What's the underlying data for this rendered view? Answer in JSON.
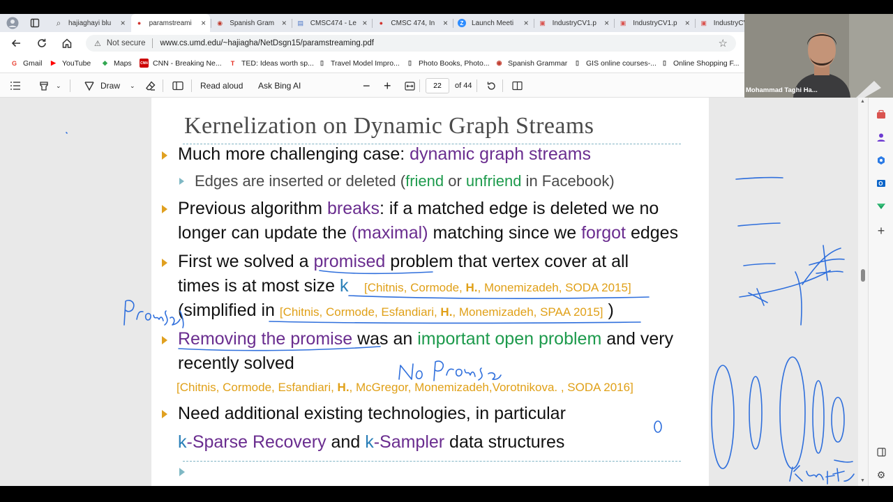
{
  "browser": {
    "tabs": [
      {
        "label": "hajiaghayi blu",
        "icon": "search-icon"
      },
      {
        "label": "paramstreami",
        "icon": "umd-icon"
      },
      {
        "label": "Spanish Gram",
        "icon": "spanish-icon"
      },
      {
        "label": "CMSC474 - Le",
        "icon": "doc-icon"
      },
      {
        "label": "CMSC 474, In",
        "icon": "umd-icon"
      },
      {
        "label": "Launch Meeti",
        "icon": "zoom-icon"
      },
      {
        "label": "IndustryCV1.p",
        "icon": "pdf-icon"
      },
      {
        "label": "IndustryCV1.p",
        "icon": "pdf-icon"
      },
      {
        "label": "IndustryCV",
        "icon": "pdf-icon"
      }
    ],
    "not_secure": "Not secure",
    "url": "www.cs.umd.edu/~hajiagha/NetDsgn15/paramstreaming.pdf",
    "bookmarks": [
      {
        "label": "Gmail",
        "icon": "G",
        "color": "#ea4335"
      },
      {
        "label": "YouTube",
        "icon": "▶",
        "color": "#ff0000"
      },
      {
        "label": "Maps",
        "icon": "◆",
        "color": "#34a853"
      },
      {
        "label": "CNN - Breaking Ne...",
        "icon": "CNN",
        "color": "#cc0000"
      },
      {
        "label": "TED: Ideas worth sp...",
        "icon": "T",
        "color": "#e62b1e"
      },
      {
        "label": "Travel Model Impro...",
        "icon": "▯",
        "color": "#444444"
      },
      {
        "label": "Photo Books, Photo...",
        "icon": "▯",
        "color": "#444444"
      },
      {
        "label": "Spanish Grammar",
        "icon": "◉",
        "color": "#c0392b"
      },
      {
        "label": "GIS online courses-...",
        "icon": "▯",
        "color": "#444444"
      },
      {
        "label": "Online Shopping F...",
        "icon": "▯",
        "color": "#444444"
      }
    ]
  },
  "pdf_toolbar": {
    "draw": "Draw",
    "read_aloud": "Read aloud",
    "ask_bing": "Ask Bing AI",
    "page": "22",
    "of_pages": "of 44"
  },
  "webcam": {
    "name": "Mohammad Taghi Ha..."
  },
  "slide": {
    "title": "Kernelization on Dynamic Graph Streams",
    "b1_a": "Much more challenging case: ",
    "b1_b": "dynamic graph streams",
    "s1_a": "Edges are inserted or deleted (",
    "s1_b": "friend",
    "s1_c": " or ",
    "s1_d": "unfriend",
    "s1_e": " in Facebook)",
    "b2_a": "Previous algorithm ",
    "b2_b": "breaks",
    "b2_c": ": if a matched edge is deleted we no",
    "b2_d": "longer can update the ",
    "b2_e": "(maximal)",
    "b2_f": " matching since we ",
    "b2_g": "forgot",
    "b2_h": " edges",
    "b3_a": "First we solved a ",
    "b3_b": "promised",
    "b3_c": " problem that vertex cover at all",
    "b3_d": "times is at most size ",
    "b3_e": "k",
    "cite1_a": "[Chitnis, Cormode, ",
    "cite1_b": "H.",
    "cite1_c": ", Monemizadeh, SODA 2015]",
    "b3_f": "(simplified in ",
    "cite2_a": "[Chitnis, Cormode, Esfandiari, ",
    "cite2_b": "H.",
    "cite2_c": ", Monemizadeh,  SPAA 2015]",
    "b3_g": " )",
    "b4_a": "Removing the promise",
    "b4_b": " was an ",
    "b4_c": "important open problem",
    "b4_d": " and very",
    "b4_e": "recently solved",
    "cite3_a": "[Chitnis, Cormode, Esfandiari, ",
    "cite3_b": "H.",
    "cite3_c": ", McGregor, Monemizadeh,Vorotnikova. , SODA 2016]",
    "b5_a": "Need additional existing technologies, in particular",
    "b5_b": "k",
    "b5_c": "-Sparse Recovery",
    "b5_d": " and ",
    "b5_e": "k",
    "b5_f": "-Sampler",
    "b5_g": " data structures"
  }
}
